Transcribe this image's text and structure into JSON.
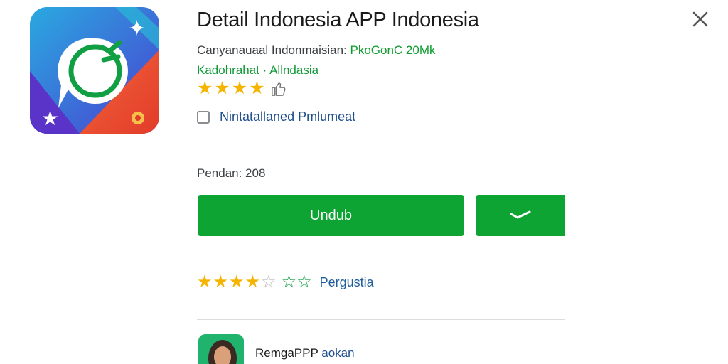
{
  "title": "Detail Indonesia APP Indonesia",
  "meta": {
    "developer_text": "Canyanauaal Indonmaisian:",
    "size_text": "PkoGonC 20Mk",
    "category_text": "Kadohrahat · Allndasia"
  },
  "rating_top": {
    "value": 4,
    "max": 5
  },
  "checkbox": {
    "label": "Nintatallaned Pmlumeat",
    "checked": false
  },
  "pending_text": "Pendan: 208",
  "buttons": {
    "download_label": "Undub"
  },
  "rating_bottom": {
    "value": 3.5,
    "max": 5,
    "extra_stars_text": "☆☆",
    "label": "Pergustia"
  },
  "developer_card": {
    "name": "RemgaPPP",
    "extra": "aokan"
  },
  "icons": {
    "app": "app-logo-icon",
    "close": "close-icon",
    "thumb": "thumb-up-icon",
    "dropdown": "chevron-down-icon",
    "avatar": "developer-avatar-icon"
  },
  "colors": {
    "accent_green": "#0ea433",
    "link_blue": "#1f4e8c",
    "star_yellow": "#f4b400"
  }
}
